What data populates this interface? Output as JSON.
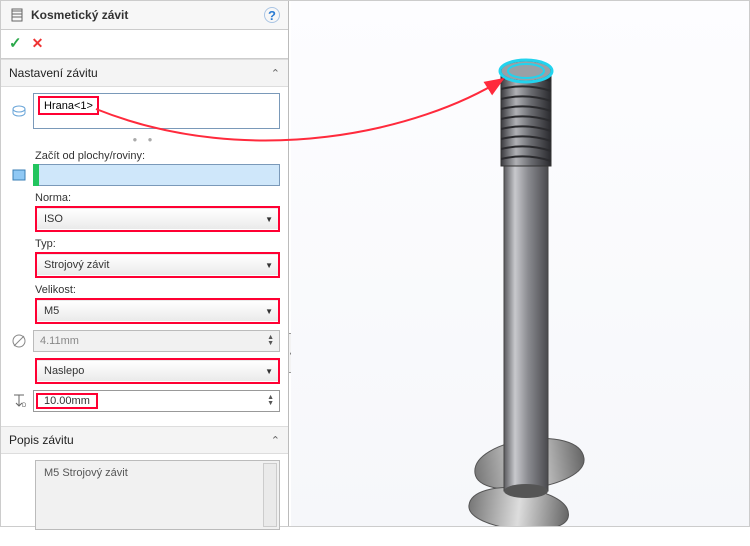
{
  "header": {
    "title": "Kosmetický závit"
  },
  "sections": {
    "settings": {
      "title": "Nastavení závitu",
      "edge_item": "Hrana<1>",
      "start_from_label": "Začít od plochy/roviny:",
      "standard_label": "Norma:",
      "standard_value": "ISO",
      "type_label": "Typ:",
      "type_value": "Strojový závit",
      "size_label": "Velikost:",
      "size_value": "M5",
      "diameter_value": "4.11mm",
      "end_condition_value": "Naslepo",
      "depth_value": "10.00mm"
    },
    "description": {
      "title": "Popis závitu",
      "value": "M5 Strojový závit"
    }
  },
  "icons": {
    "feature": "cosmetic-thread-icon",
    "help": "?",
    "ok": "✓",
    "cancel": "✕",
    "edge_select": "edge-select-icon",
    "face_select": "face-select-icon",
    "diameter": "diameter-icon",
    "depth": "depth-icon"
  }
}
